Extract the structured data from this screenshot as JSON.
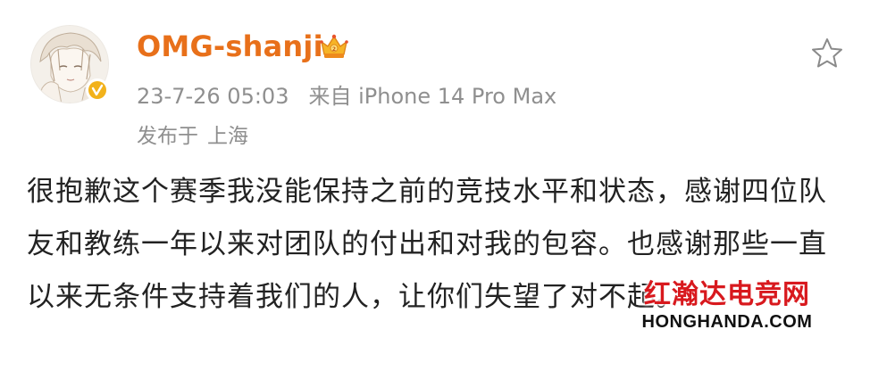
{
  "post": {
    "username": "OMG-shanji",
    "timestamp": "23-7-26 05:03",
    "source": "来自 iPhone 14 Pro Max",
    "location_prefix": "发布于",
    "location": "上海",
    "content": "很抱歉这个赛季我没能保持之前的竞技水平和状态，感谢四位队友和教练一年以来对团队的付出和对我的包容。也感谢那些一直以来无条件支持着我们的人，让你们失望了对不起。"
  },
  "icons": {
    "avatar": "anime-avatar",
    "verified": "verified-badge-icon",
    "member": "crown-badge-icon",
    "favorite": "star-icon"
  },
  "colors": {
    "username": "#e8701a",
    "meta": "#8f8f8f",
    "content": "#222222",
    "verified": "#f2b21b",
    "watermark": "#d8191e"
  },
  "watermark": {
    "title": "红瀚达电竞网",
    "subtitle": "HONGHANDA.COM"
  }
}
